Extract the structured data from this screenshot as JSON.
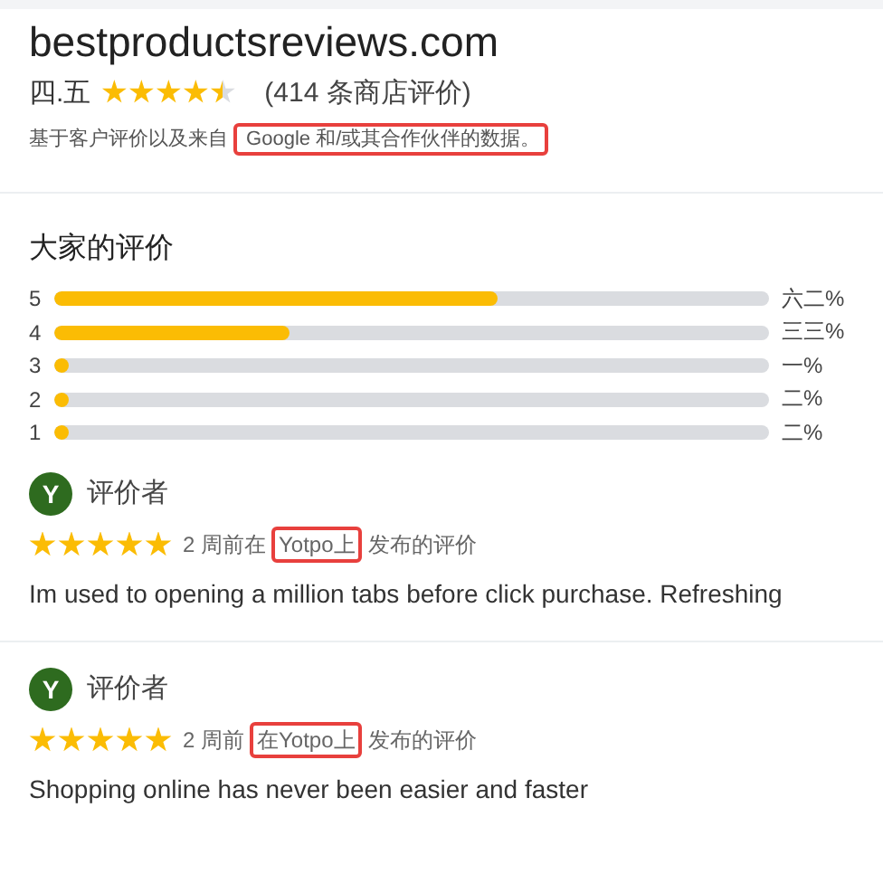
{
  "site": {
    "title": "bestproductsreviews.com",
    "rating": "四.五",
    "stars": 4.5,
    "count": "(414 条商店评价)",
    "note": [
      {
        "text": "基于客户评价以及来自",
        "highlighted": false
      },
      {
        "text": " Google 和/或其合作伙伴的数据。",
        "highlighted": true
      }
    ]
  },
  "summary": {
    "heading": "大家的评价",
    "rows": [
      {
        "label": "5",
        "level": 0.62,
        "percent": "六二%"
      },
      {
        "label": "4",
        "level": 0.33,
        "percent": "三三%"
      },
      {
        "label": "3",
        "level": 0.01,
        "percent": "一%"
      },
      {
        "label": "2",
        "level": 0.02,
        "percent": "二%"
      },
      {
        "label": "1",
        "level": 0.02,
        "percent": "二%"
      }
    ]
  },
  "reviews": [
    {
      "initial": "Y",
      "author": "评价者",
      "stars": 5,
      "meta": [
        {
          "text": "2 周前在",
          "highlighted": false
        },
        {
          "text": "Yotpo上",
          "highlighted": true
        },
        {
          "text": "发布的评价",
          "highlighted": false
        }
      ],
      "text": "Im used to opening a million tabs before click purchase. Refreshing"
    },
    {
      "initial": "Y",
      "author": "评价者",
      "stars": 5,
      "meta": [
        {
          "text": "2 周前",
          "highlighted": false
        },
        {
          "text": "在Yotpo上",
          "highlighted": true
        },
        {
          "text": "发布的评价",
          "highlighted": false
        }
      ],
      "text": "Shopping online has never been easier and faster"
    }
  ]
}
